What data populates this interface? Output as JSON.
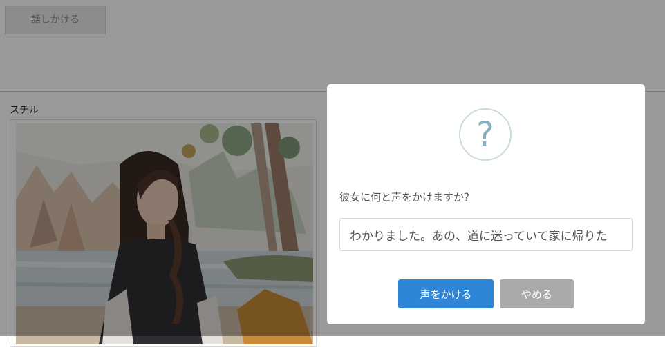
{
  "background": {
    "talk_button_label": "話しかける",
    "still_label": "スチル"
  },
  "modal": {
    "icon": "question-icon",
    "icon_glyph": "?",
    "prompt": "彼女に何と声をかけますか？",
    "input_value": "わかりました。あの、道に迷っていて家に帰りた",
    "confirm_label": "声をかける",
    "cancel_label": "やめる"
  },
  "colors": {
    "confirm": "#2f86d8",
    "cancel": "#aaaaaa",
    "icon_ring": "#c9dae1",
    "icon_glyph": "#87adbd"
  }
}
